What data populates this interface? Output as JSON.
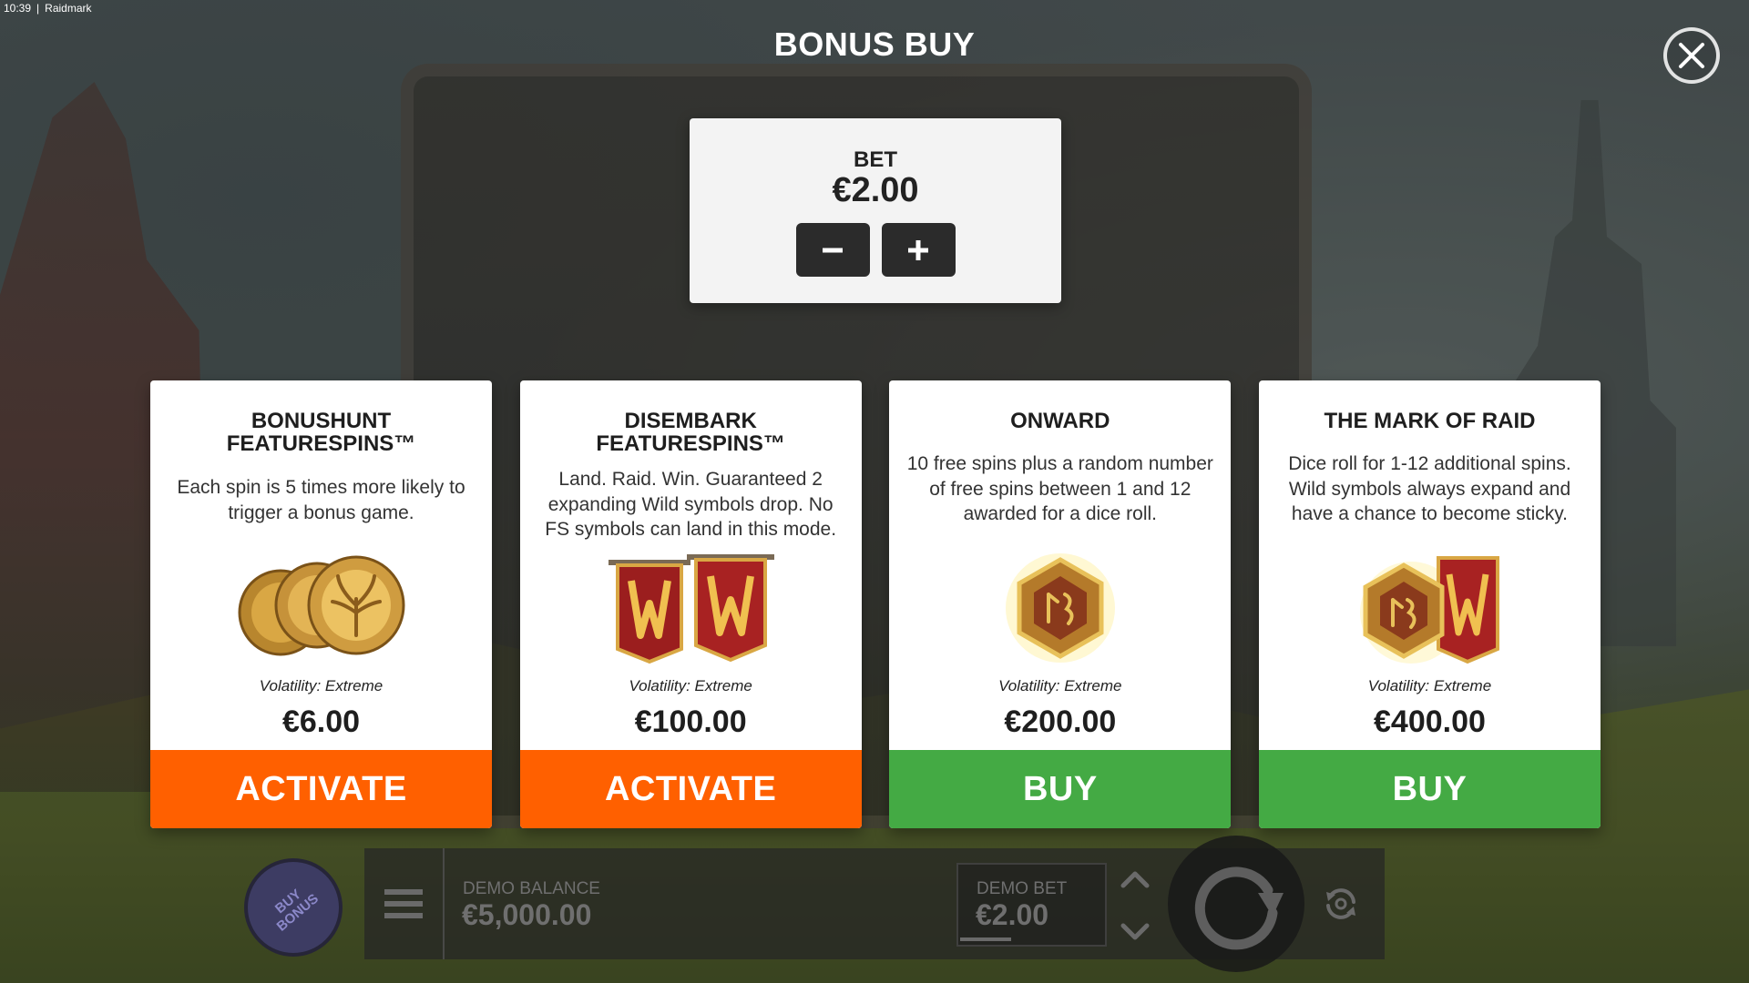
{
  "status_bar": {
    "time": "10:39",
    "separator": "|",
    "app_name": "Raidmark"
  },
  "title": "BONUS BUY",
  "bet_panel": {
    "label": "BET",
    "value": "€2.00",
    "decrease_symbol": "−",
    "increase_symbol": "+"
  },
  "cards": [
    {
      "title": "BONUSHUNT FEATURESPINS™",
      "description": "Each spin is 5 times more likely to trigger a bonus game.",
      "art_icon": "gold-coins-icon",
      "volatility": "Volatility: Extreme",
      "price": "€6.00",
      "action": "ACTIVATE",
      "action_color": "#ff6000"
    },
    {
      "title": "DISEMBARK FEATURESPINS™",
      "description": "Land. Raid. Win. Guaranteed 2 expanding Wild symbols drop. No FS symbols can land in this mode.",
      "art_icon": "wild-banners-icon",
      "volatility": "Volatility: Extreme",
      "price": "€100.00",
      "action": "ACTIVATE",
      "action_color": "#ff6000"
    },
    {
      "title": "ONWARD",
      "description": "10 free spins plus a random number of free spins between 1 and 12 awarded for a dice roll.",
      "art_icon": "rune-dice-icon",
      "volatility": "Volatility: Extreme",
      "price": "€200.00",
      "action": "BUY",
      "action_color": "#44aa44"
    },
    {
      "title": "THE MARK OF RAID",
      "description": "Dice roll for 1-12 additional spins. Wild symbols always expand and have a chance to become sticky.",
      "art_icon": "dice-and-banner-icon",
      "volatility": "Volatility: Extreme",
      "price": "€400.00",
      "action": "BUY",
      "action_color": "#44aa44"
    }
  ],
  "bottom_bar": {
    "buy_bonus_label": "BUY BONUS",
    "balance_label": "DEMO BALANCE",
    "balance_value": "€5,000.00",
    "bet_label": "DEMO BET",
    "bet_value": "€2.00"
  },
  "colors": {
    "activate": "#ff6000",
    "buy": "#44aa44",
    "card_bg": "#ffffff",
    "bet_panel_bg": "#f3f3f3"
  }
}
